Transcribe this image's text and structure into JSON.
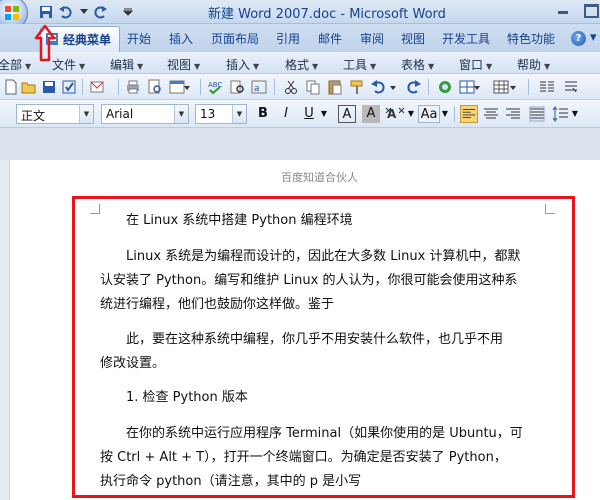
{
  "window": {
    "title": "新建 Word 2007.doc - Microsoft Word"
  },
  "ribbon": {
    "tabs": [
      {
        "label": "经典菜单",
        "active": true
      },
      {
        "label": "开始"
      },
      {
        "label": "插入"
      },
      {
        "label": "页面布局"
      },
      {
        "label": "引用"
      },
      {
        "label": "邮件"
      },
      {
        "label": "审阅"
      },
      {
        "label": "视图"
      },
      {
        "label": "开发工具"
      },
      {
        "label": "特色功能"
      }
    ],
    "help": "?"
  },
  "menubar": {
    "items": [
      "全部",
      "文件",
      "编辑",
      "视图",
      "插入",
      "格式",
      "工具",
      "表格",
      "窗口",
      "帮助"
    ]
  },
  "formatting": {
    "style": "正文",
    "font": "Arial",
    "size": "13",
    "bold": "B",
    "italic": "I",
    "underline": "U",
    "char_border": "A",
    "char_shading": "A",
    "change_case": "Aa"
  },
  "document": {
    "header_text": "百度知道合伙人",
    "paragraphs": [
      "在 Linux 系统中搭建 Python 编程环境",
      "Linux 系统是为编程而设计的，因此在大多数 Linux 计算机中，都默",
      "认安装了 Python。编写和维护 Linux 的人认为，你很可能会使用这种系",
      "统进行编程，他们也鼓励你这样做。鉴于",
      "此，要在这种系统中编程，你几乎不用安装什么软件，也几乎不用",
      "修改设置。",
      "1. 检查 Python 版本",
      "在你的系统中运行应用程序 Terminal（如果你使用的是 Ubuntu，可",
      "按 Ctrl + Alt + T），打开一个终端窗口。为确定是否安装了 Python，",
      "执行命令 python（请注意，其中的 p 是小写"
    ]
  },
  "colors": {
    "highlight_box": "#e5141d",
    "annotation_arrow": "#e5141d",
    "title_text": "#15428b"
  }
}
